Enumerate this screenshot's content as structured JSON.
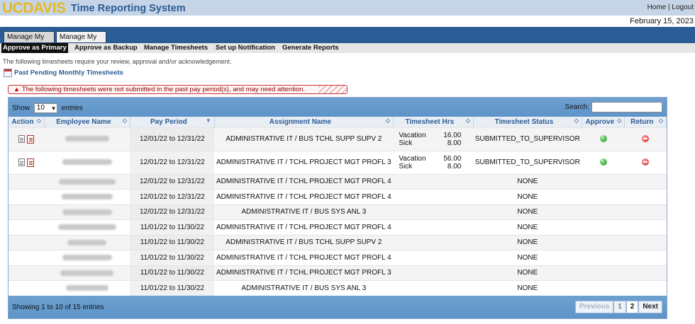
{
  "header": {
    "logo_text": "UCDAVIS",
    "app_title": "Time Reporting System",
    "links": [
      "Home",
      "Logout"
    ],
    "date": "February 15, 2023"
  },
  "tabs": [
    "Manage My Staff",
    "Manage My Time"
  ],
  "subnav": [
    "Approve as Primary",
    "Approve as Backup",
    "Manage Timesheets",
    "Set up Notification",
    "Generate Reports"
  ],
  "intro": "The following timesheets require your review, approval and/or acknowledgement.",
  "section_title": "Past Pending Monthly Timesheets",
  "alert": "The following timesheets were not submitted in the past pay period(s), and may need attention.",
  "grid": {
    "show_label": "Show",
    "entries_value": "10",
    "entries_label": "entries",
    "search_label": "Search:",
    "columns": [
      "Action",
      "Employee Name",
      "Pay Period",
      "Assignment Name",
      "Timesheet Hrs",
      "Timesheet Status",
      "Approve",
      "Return"
    ],
    "rows": [
      {
        "period": "12/01/22 to 12/31/22",
        "assignment": "ADMINISTRATIVE IT / BUS TCHL SUPP SUPV 2",
        "hrs": [
          [
            "Vacation",
            "16.00"
          ],
          [
            "Sick",
            "8.00"
          ]
        ],
        "status": "SUBMITTED_TO_SUPERVISOR",
        "actions": true
      },
      {
        "period": "12/01/22 to 12/31/22",
        "assignment": "ADMINISTRATIVE IT / TCHL PROJECT MGT PROFL 3",
        "hrs": [
          [
            "Vacation",
            "56.00"
          ],
          [
            "Sick",
            "8.00"
          ]
        ],
        "status": "SUBMITTED_TO_SUPERVISOR",
        "actions": true
      },
      {
        "period": "12/01/22 to 12/31/22",
        "assignment": "ADMINISTRATIVE IT / TCHL PROJECT MGT PROFL 4",
        "hrs": [],
        "status": "NONE",
        "actions": false
      },
      {
        "period": "12/01/22 to 12/31/22",
        "assignment": "ADMINISTRATIVE IT / TCHL PROJECT MGT PROFL 4",
        "hrs": [],
        "status": "NONE",
        "actions": false
      },
      {
        "period": "12/01/22 to 12/31/22",
        "assignment": "ADMINISTRATIVE IT / BUS SYS ANL 3",
        "hrs": [],
        "status": "NONE",
        "actions": false
      },
      {
        "period": "11/01/22 to 11/30/22",
        "assignment": "ADMINISTRATIVE IT / TCHL PROJECT MGT PROFL 4",
        "hrs": [],
        "status": "NONE",
        "actions": false
      },
      {
        "period": "11/01/22 to 11/30/22",
        "assignment": "ADMINISTRATIVE IT / BUS TCHL SUPP SUPV 2",
        "hrs": [],
        "status": "NONE",
        "actions": false
      },
      {
        "period": "11/01/22 to 11/30/22",
        "assignment": "ADMINISTRATIVE IT / TCHL PROJECT MGT PROFL 4",
        "hrs": [],
        "status": "NONE",
        "actions": false
      },
      {
        "period": "11/01/22 to 11/30/22",
        "assignment": "ADMINISTRATIVE IT / TCHL PROJECT MGT PROFL 3",
        "hrs": [],
        "status": "NONE",
        "actions": false
      },
      {
        "period": "11/01/22 to 11/30/22",
        "assignment": "ADMINISTRATIVE IT / BUS SYS ANL 3",
        "hrs": [],
        "status": "NONE",
        "actions": false
      }
    ],
    "footer_info": "Showing 1 to 10 of 15 entries",
    "pager": {
      "previous": "Previous",
      "pages": [
        "1",
        "2"
      ],
      "next": "Next"
    }
  },
  "colors": {
    "brand_gold": "#e8b923",
    "brand_blue": "#2b5c95",
    "alert_red": "#cc3333"
  }
}
